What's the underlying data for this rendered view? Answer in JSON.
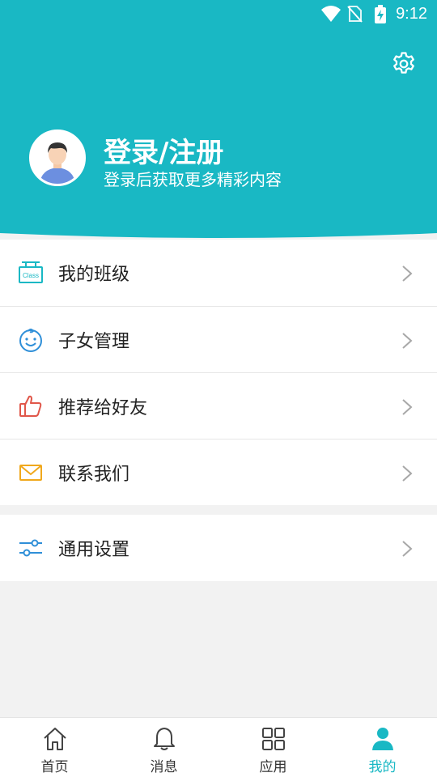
{
  "status_bar": {
    "time": "9:12",
    "icons": [
      "wifi-icon",
      "no-sim-icon",
      "battery-charging-icon"
    ]
  },
  "colors": {
    "accent": "#19b8c4",
    "text": "#222222",
    "chevron": "#a8a8a8",
    "page_bg": "#f2f2f2"
  },
  "header": {
    "settings_icon": "gear-icon",
    "login_title": "登录/注册",
    "login_subtitle": "登录后获取更多精彩内容"
  },
  "menu": {
    "items": [
      {
        "label": "我的班级",
        "icon": "class-sign-icon"
      },
      {
        "label": "子女管理",
        "icon": "baby-face-icon"
      },
      {
        "label": "推荐给好友",
        "icon": "thumbs-up-icon"
      },
      {
        "label": "联系我们",
        "icon": "mail-icon"
      }
    ],
    "settings_item": {
      "label": "通用设置",
      "icon": "sliders-icon"
    }
  },
  "tabbar": {
    "tabs": [
      {
        "label": "首页",
        "icon": "home-icon"
      },
      {
        "label": "消息",
        "icon": "bell-icon"
      },
      {
        "label": "应用",
        "icon": "grid-icon"
      },
      {
        "label": "我的",
        "icon": "person-icon",
        "active": true
      }
    ]
  }
}
